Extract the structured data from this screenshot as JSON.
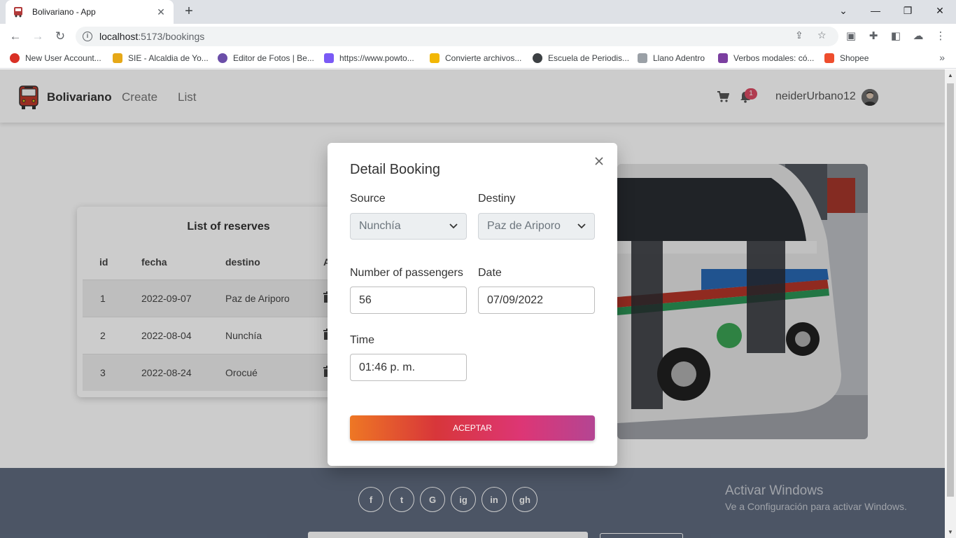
{
  "browser": {
    "tab_title": "Bolivariano - App",
    "url_host": "localhost",
    "url_rest": ":5173/bookings",
    "bookmarks": [
      {
        "label": "New User Account...",
        "color": "#d93025"
      },
      {
        "label": "SIE - Alcaldia de Yo...",
        "color": "#e6a817"
      },
      {
        "label": "Editor de Fotos | Be...",
        "color": "#6b4ea8"
      },
      {
        "label": "https://www.powto...",
        "color": "#7a5af5"
      },
      {
        "label": "Convierte archivos...",
        "color": "#f2b705"
      },
      {
        "label": "Escuela de Periodis...",
        "color": "#3c4043"
      },
      {
        "label": "Llano Adentro",
        "color": "#9aa0a6"
      },
      {
        "label": "Verbos modales: có...",
        "color": "#7b3fa0"
      },
      {
        "label": "Shopee",
        "color": "#ee4d2d"
      }
    ]
  },
  "nav": {
    "brand": "Bolivariano",
    "links": [
      "Create",
      "List"
    ],
    "notifications": "1",
    "username": "neiderUrbano12"
  },
  "reserves": {
    "title": "List of reserves",
    "columns": [
      "id",
      "fecha",
      "destino",
      "A"
    ],
    "rows": [
      {
        "id": "1",
        "fecha": "2022-09-07",
        "destino": "Paz de Ariporo"
      },
      {
        "id": "2",
        "fecha": "2022-08-04",
        "destino": "Nunchía"
      },
      {
        "id": "3",
        "fecha": "2022-08-24",
        "destino": "Orocué"
      }
    ]
  },
  "modal": {
    "title": "Detail Booking",
    "source_label": "Source",
    "source_value": "Nunchía",
    "destiny_label": "Destiny",
    "destiny_value": "Paz de Ariporo",
    "passengers_label": "Number of passengers",
    "passengers_value": "56",
    "date_label": "Date",
    "date_value": "07/09/2022",
    "time_label": "Time",
    "time_value": "01:46 p. m.",
    "accept_label": "ACEPTAR"
  },
  "footer": {
    "social": [
      "f",
      "t",
      "G",
      "ig",
      "in",
      "gh"
    ],
    "watermark_title": "Activar Windows",
    "watermark_sub": "Ve a Configuración para activar Windows."
  }
}
